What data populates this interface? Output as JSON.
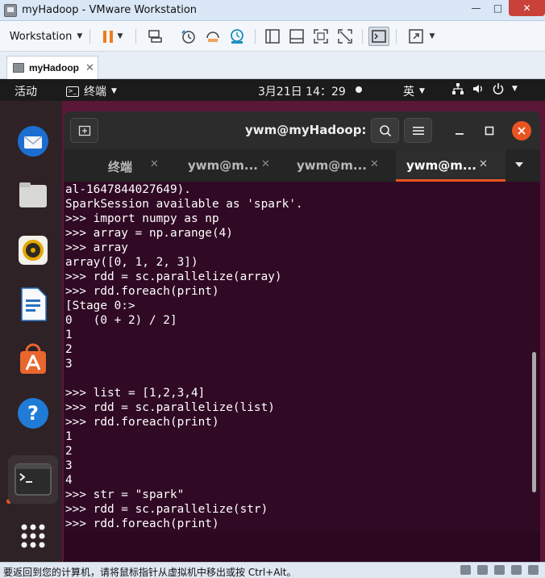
{
  "window": {
    "title": "myHadoop - VMware Workstation",
    "buttons": {
      "minimize": "—",
      "maximize": "□",
      "close": "✕"
    }
  },
  "toolbar": {
    "workstation_menu": "Workstation",
    "items": [
      "power-pause",
      "send-keys",
      "snapshot",
      "revert-snapshot",
      "manage-snapshots",
      "library-view",
      "console-view",
      "full-screen",
      "unity",
      "terminal-view",
      "stretch"
    ]
  },
  "vm_tab": {
    "label": "myHadoop",
    "close": "✕"
  },
  "guest": {
    "topbar": {
      "activities": "活动",
      "app_menu": "终端",
      "clock": "3月21日 14：29",
      "input_method": "英"
    },
    "dock": [
      "thunderbird",
      "files",
      "rhythmbox",
      "libreoffice-writer",
      "ubuntu-software",
      "help",
      "terminal",
      "show-applications"
    ]
  },
  "terminal": {
    "title": "ywm@myHadoop: ~",
    "tabs": [
      {
        "label": "终端",
        "active": false
      },
      {
        "label": "ywm@m...",
        "active": false
      },
      {
        "label": "ywm@m...",
        "active": false
      },
      {
        "label": "ywm@m...",
        "active": true
      }
    ],
    "lines": [
      "al-1647844027649).",
      "SparkSession available as 'spark'.",
      ">>> import numpy as np",
      ">>> array = np.arange(4)",
      ">>> array",
      "array([0, 1, 2, 3])",
      ">>> rdd = sc.parallelize(array)",
      ">>> rdd.foreach(print)",
      "[Stage 0:>",
      "0   (0 + 2) / 2]",
      "1",
      "2",
      "3",
      "",
      ">>> list = [1,2,3,4]",
      ">>> rdd = sc.parallelize(list)",
      ">>> rdd.foreach(print)",
      "1",
      "2",
      "3",
      "4",
      ">>> str = \"spark\"",
      ">>> rdd = sc.parallelize(str)",
      ">>> rdd.foreach(print)"
    ]
  },
  "statusbar": {
    "text": "要返回到您的计算机，请将鼠标指针从虚拟机中移出或按 Ctrl+Alt。"
  },
  "colors": {
    "terminal_bg": "#300a24",
    "accent": "#e95420",
    "pause": "#f07b1b"
  }
}
